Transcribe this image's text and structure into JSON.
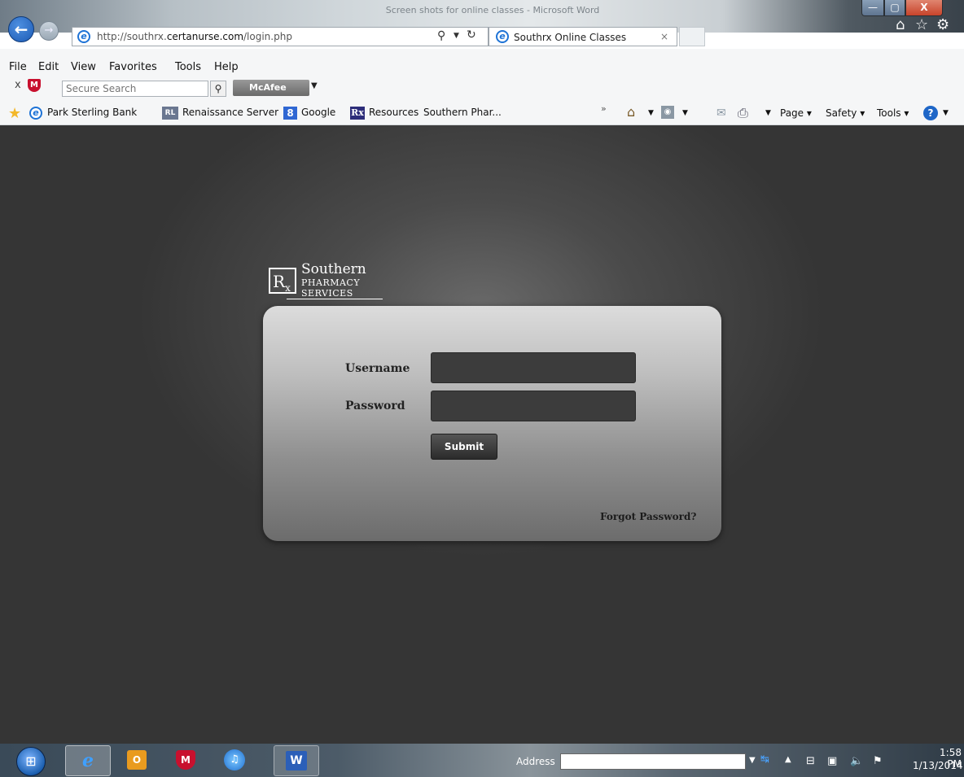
{
  "window": {
    "title": "Screen shots for online classes - Microsoft Word",
    "minimize": "—",
    "maximize": "▢",
    "close": "X"
  },
  "browser": {
    "url_prefix": "http://southrx.",
    "url_domain": "certanurse.com",
    "url_path": "/login.php",
    "tab_title": "Southrx Online Classes",
    "tab_close": "×"
  },
  "menu": [
    "File",
    "Edit",
    "View",
    "Favorites",
    "Tools",
    "Help"
  ],
  "mcafee": {
    "search_placeholder": "Secure Search",
    "button_label": "McAfee"
  },
  "favorites": {
    "items": [
      "Park Sterling Bank",
      "Renaissance Server",
      "Google",
      "Resources",
      "Southern Phar..."
    ],
    "rl_badge": "RL",
    "google_badge": "8",
    "rx_badge": "Rx"
  },
  "command_bar": {
    "page": "Page ▾",
    "safety": "Safety ▾",
    "tools": "Tools ▾"
  },
  "logo": {
    "mark": "R",
    "mark_sub": "x",
    "line1": "Southern",
    "line2": "PHARMACY",
    "line3": "SERVICES"
  },
  "login": {
    "username_label": "Username",
    "password_label": "Password",
    "submit_label": "Submit",
    "forgot_label": "Forgot Password?"
  },
  "taskbar": {
    "address_label": "Address",
    "time": "1:58 PM",
    "date": "1/13/2014",
    "ie": "e",
    "outlook": "O",
    "mcafee": "M",
    "itunes": "♫",
    "word": "W"
  },
  "colors": {
    "page_background": "#3a3a3a",
    "panel_top": "#dcdcdc",
    "panel_bottom": "#6c6c6c",
    "field_background": "#3c3c3c",
    "ie_blue": "#1e73d6"
  }
}
